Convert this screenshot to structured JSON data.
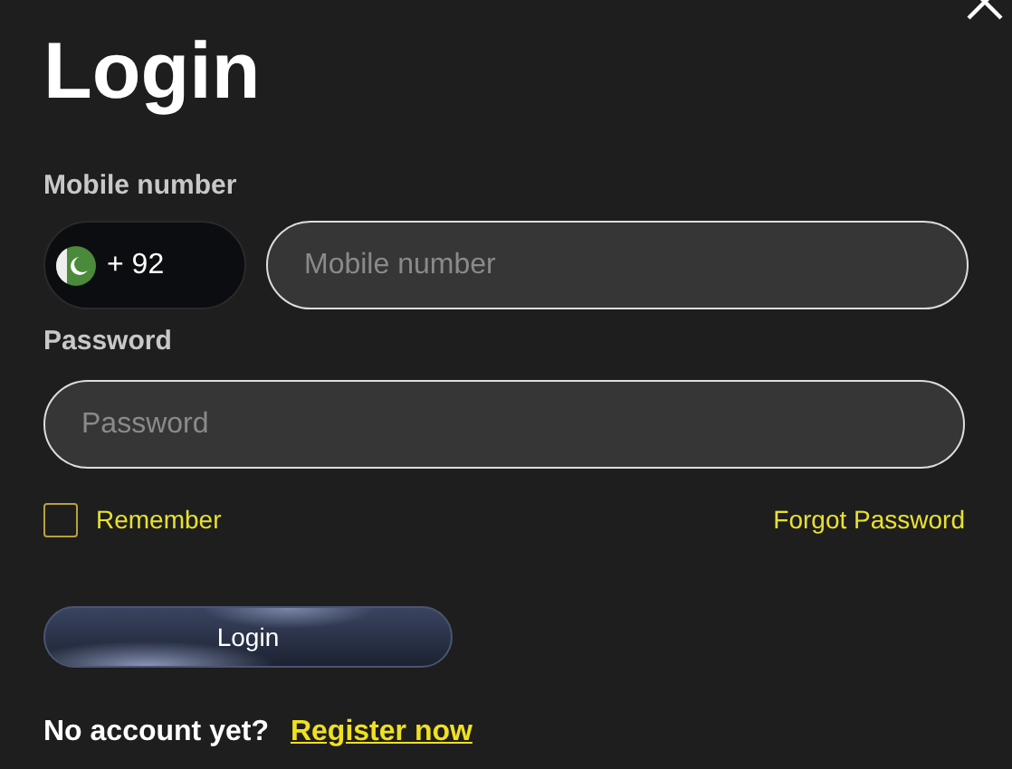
{
  "title": "Login",
  "mobile": {
    "label": "Mobile number",
    "country_code": "+ 92",
    "placeholder": "Mobile number"
  },
  "password": {
    "label": "Password",
    "placeholder": "Password"
  },
  "remember": {
    "label": "Remember",
    "checked": false
  },
  "forgot_link": "Forgot Password",
  "submit": "Login",
  "footer": {
    "text": "No account yet?",
    "link": "Register now"
  }
}
